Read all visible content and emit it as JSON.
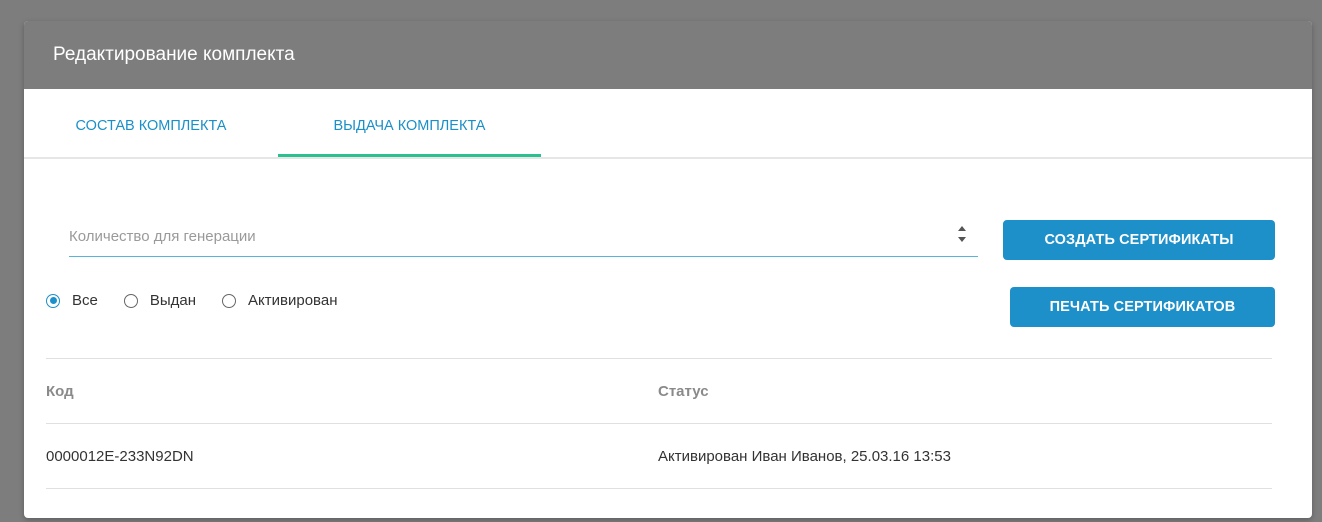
{
  "dialog": {
    "title": "Редактирование комплекта"
  },
  "tabs": [
    {
      "label": "СОСТАВ КОМПЛЕКТА",
      "active": false
    },
    {
      "label": "ВЫДАЧА КОМПЛЕКТА",
      "active": true
    }
  ],
  "generation": {
    "placeholder": "Количество для генерации",
    "value": "",
    "create_button": "СОЗДАТЬ СЕРТИФИКАТЫ",
    "print_button": "ПЕЧАТЬ СЕРТИФИКАТОВ"
  },
  "filter": {
    "options": [
      "Все",
      "Выдан",
      "Активирован"
    ],
    "selected": "Все"
  },
  "table": {
    "headers": [
      "Код",
      "Статус"
    ],
    "rows": [
      [
        "0000012E-233N92DN",
        "Активирован Иван Иванов, 25.03.16 13:53"
      ]
    ]
  },
  "colors": {
    "accent": "#1d8fc9",
    "tab_indicator": "#2bbf91",
    "header_bg": "#7d7d7d"
  }
}
